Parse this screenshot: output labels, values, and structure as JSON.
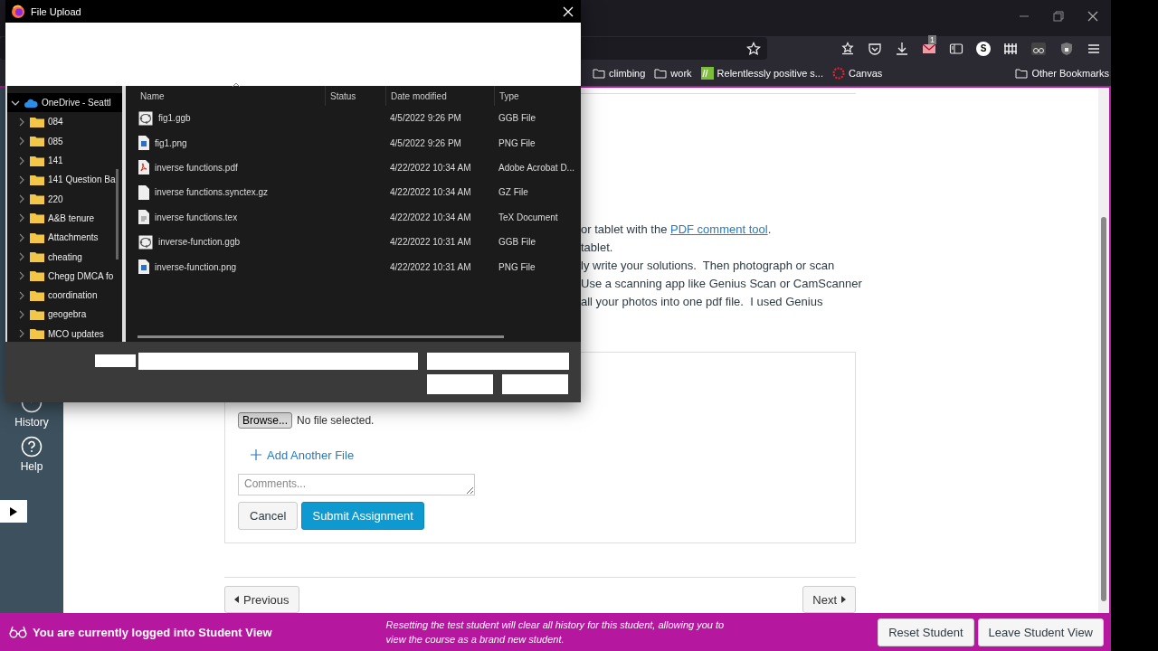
{
  "browser": {
    "bookmarks": [
      {
        "label": "climbing",
        "kind": "folder"
      },
      {
        "label": "work",
        "kind": "folder"
      },
      {
        "label": "Relentlessly positive s...",
        "kind": "site"
      },
      {
        "label": "Canvas",
        "kind": "canvas"
      }
    ],
    "other_bookmarks": "Other Bookmarks",
    "mail_badge": "1",
    "account_initial": "S"
  },
  "nav": [
    {
      "label": "History",
      "kind": "history"
    },
    {
      "label": "Help",
      "kind": "help"
    }
  ],
  "instructions": [
    {
      "text": "or tablet with the ",
      "link": "PDF comment tool",
      "after": "."
    },
    {
      "text": "tablet."
    },
    {
      "text": "ly write your solutions.  Then photograph or scan"
    },
    {
      "text": "Use a scanning app like Genius Scan or CamScanner"
    },
    {
      "text": "all your photos into one pdf file.  I used Genius"
    }
  ],
  "upload": {
    "browse": "Browse...",
    "file_status": "No file selected.",
    "add_file": "Add Another File",
    "comments_placeholder": "Comments...",
    "cancel": "Cancel",
    "submit": "Submit Assignment"
  },
  "pager": {
    "previous": "Previous",
    "next": "Next"
  },
  "student_view": {
    "message": "You are currently logged into Student View",
    "note": "Resetting the test student will clear all history for this student, allowing you to view the course as a brand new student.",
    "buttons": [
      "Reset Student",
      "Leave Student View"
    ]
  },
  "dialog": {
    "title": "File Upload",
    "tree": {
      "label": "OneDrive - Seattl",
      "expanded": true,
      "children": [
        {
          "label": "084",
          "expanded": false
        },
        {
          "label": "085",
          "expanded": false
        },
        {
          "label": "141",
          "expanded": false
        },
        {
          "label": "141 Question Ba",
          "expanded": false
        },
        {
          "label": "220",
          "expanded": false
        },
        {
          "label": "A&B tenure",
          "expanded": false
        },
        {
          "label": "Attachments",
          "expanded": false
        },
        {
          "label": "cheating",
          "expanded": false
        },
        {
          "label": "Chegg DMCA fo",
          "expanded": false
        },
        {
          "label": "coordination",
          "expanded": false
        },
        {
          "label": "geogebra",
          "expanded": false
        },
        {
          "label": "MCO updates",
          "expanded": false
        }
      ]
    },
    "columns": [
      "Name",
      "Status",
      "Date modified",
      "Type"
    ],
    "files": [
      {
        "name": "fig1.ggb",
        "kind": "ggb",
        "date": "4/5/2022 9:26 PM",
        "type": "GGB File"
      },
      {
        "name": "fig1.png",
        "kind": "image",
        "date": "4/5/2022 9:26 PM",
        "type": "PNG File"
      },
      {
        "name": "inverse functions.pdf",
        "kind": "pdf",
        "date": "4/22/2022 10:34 AM",
        "type": "Adobe Acrobat D..."
      },
      {
        "name": "inverse functions.synctex.gz",
        "kind": "file",
        "date": "4/22/2022 10:34 AM",
        "type": "GZ File"
      },
      {
        "name": "inverse functions.tex",
        "kind": "tex",
        "date": "4/22/2022 10:34 AM",
        "type": "TeX Document"
      },
      {
        "name": "inverse-function.ggb",
        "kind": "ggb",
        "date": "4/22/2022 10:31 AM",
        "type": "GGB File"
      },
      {
        "name": "inverse-function.png",
        "kind": "image",
        "date": "4/22/2022 10:31 AM",
        "type": "PNG File"
      }
    ]
  }
}
